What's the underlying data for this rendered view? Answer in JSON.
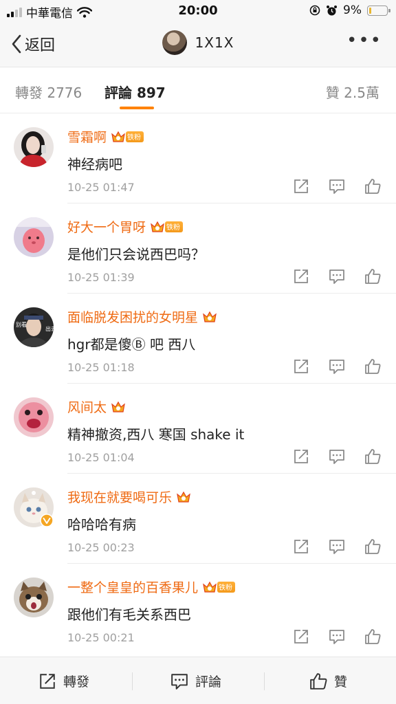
{
  "status_bar": {
    "carrier": "中華電信",
    "time": "20:00",
    "battery": "9%",
    "icons": [
      "signal-icon",
      "wifi-icon",
      "lock-rotation-icon",
      "alarm-icon",
      "battery-icon"
    ]
  },
  "nav": {
    "back_label": "返回",
    "title": "1X1X",
    "icons": [
      "back-chevron-icon",
      "more-icon"
    ]
  },
  "tabs": {
    "repost": "轉發 2776",
    "comments": "評論 897",
    "likes": "贊 2.5萬",
    "active": "comments"
  },
  "colors": {
    "accent": "#ff8200",
    "username": "#ef6b14",
    "verify_badge": "#f5a623"
  },
  "badge_text": "铁粉",
  "comments": [
    {
      "name": "雪霜啊",
      "text": "神经病吧",
      "time": "10-25 01:47",
      "fan_badge": true
    },
    {
      "name": "好大一个胃呀",
      "text": "是他们只会说西巴吗？",
      "time": "10-25 01:39",
      "fan_badge": true
    },
    {
      "name": "面临脱发困扰的女明星",
      "text": "hgr都是傻Ⓑ 吧 西八",
      "time": "10-25 01:18",
      "fan_badge": false
    },
    {
      "name": "风间太",
      "text": "精神撤资,西八 寒国 shake it",
      "time": "10-25 01:04",
      "fan_badge": false
    },
    {
      "name": "我现在就要喝可乐",
      "text": "哈哈哈有病",
      "time": "10-25 00:23",
      "fan_badge": false
    },
    {
      "name": "一整个皇皇的百香果儿",
      "text": "跟他们有毛关系西巴",
      "time": "10-25 00:21",
      "fan_badge": true
    }
  ],
  "avatar_text": {
    "left": "别看",
    "right": "出去"
  },
  "bottom_bar": {
    "repost": "轉發",
    "comment": "評論",
    "like": "贊"
  }
}
